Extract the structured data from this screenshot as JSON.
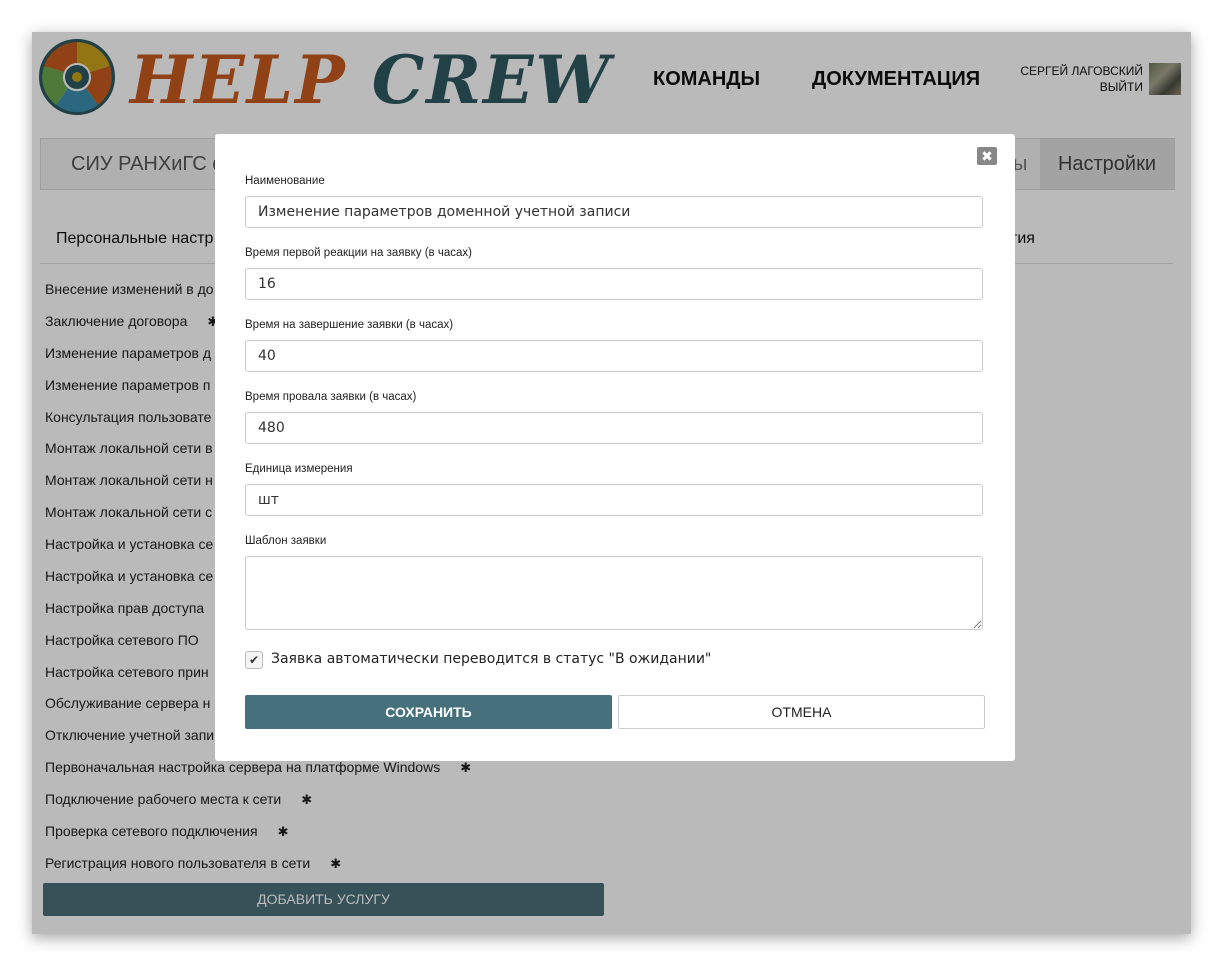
{
  "header": {
    "logo_word1": "HELP",
    "logo_word2": "CREW",
    "nav": {
      "teams": "КОМАНДЫ",
      "docs": "ДОКУМЕНТАЦИЯ"
    },
    "user": {
      "name": "СЕРГЕЙ ЛАГОВСКИЙ",
      "logout": "ВЫЙТИ"
    }
  },
  "tabs": {
    "org": "СИУ РАНХиГС с",
    "other_partial": "ы",
    "settings": "Настройки"
  },
  "subtabs": {
    "personal": "Персональные настр",
    "right_partial": "тия"
  },
  "services": [
    {
      "label": "Внесение изменений в до",
      "gear": false
    },
    {
      "label": "Заключение договора",
      "gear": true
    },
    {
      "label": "Изменение параметров д",
      "gear": false
    },
    {
      "label": "Изменение параметров п",
      "gear": false
    },
    {
      "label": "Консультация пользовате",
      "gear": false
    },
    {
      "label": "Монтаж локальной сети в",
      "gear": false
    },
    {
      "label": "Монтаж локальной сети н",
      "gear": false
    },
    {
      "label": "Монтаж локальной сети с",
      "gear": false
    },
    {
      "label": "Настройка и установка се",
      "gear": false
    },
    {
      "label": "Настройка и установка се",
      "gear": false
    },
    {
      "label": "Настройка прав доступа",
      "gear": false
    },
    {
      "label": "Настройка сетевого ПО",
      "gear": false
    },
    {
      "label": "Настройка сетевого прин",
      "gear": false
    },
    {
      "label": "Обслуживание сервера н",
      "gear": false
    },
    {
      "label": "Отключение учетной запи",
      "gear": false
    },
    {
      "label": "Первоначальная настройка сервера на платформе Windows",
      "gear": true
    },
    {
      "label": "Подключение рабочего места к сети",
      "gear": true
    },
    {
      "label": "Проверка сетевого подключения",
      "gear": true
    },
    {
      "label": "Регистрация нового пользователя в сети",
      "gear": true
    }
  ],
  "add_service_label": "ДОБАВИТЬ УСЛУГУ",
  "modal": {
    "close_symbol": "✖",
    "fields": {
      "name": {
        "label": "Наименование",
        "value": "Изменение параметров доменной учетной записи"
      },
      "first_reaction": {
        "label": "Время первой реакции на заявку (в часах)",
        "value": "16"
      },
      "completion": {
        "label": "Время на завершение заявки (в часах)",
        "value": "40"
      },
      "failure": {
        "label": "Время провала заявки (в часах)",
        "value": "480"
      },
      "unit": {
        "label": "Единица измерения",
        "value": "шт"
      },
      "template": {
        "label": "Шаблон заявки",
        "value": ""
      }
    },
    "checkbox": {
      "checked": true,
      "check_symbol": "✔",
      "label": "Заявка автоматически переводится в статус \"В ожидании\""
    },
    "save_label": "СОХРАНИТЬ",
    "cancel_label": "ОТМЕНА"
  }
}
